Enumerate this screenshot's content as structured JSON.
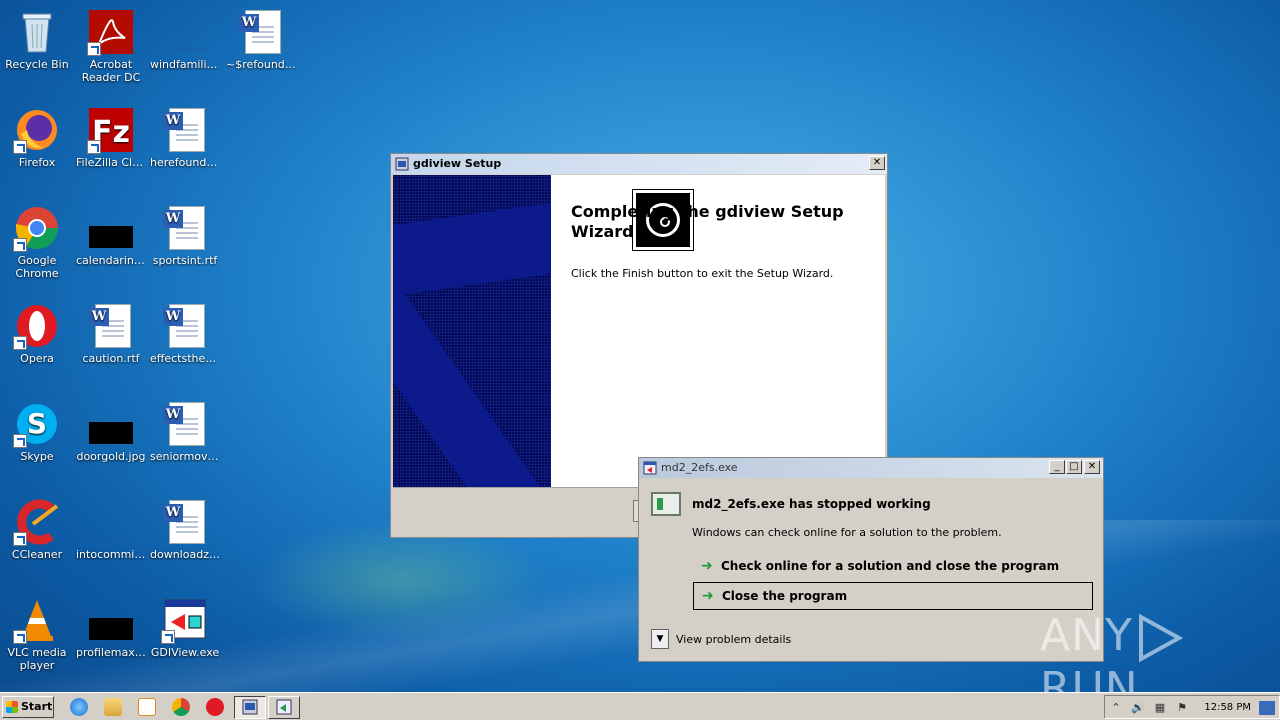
{
  "desktop": {
    "icons": [
      {
        "label": "Recycle Bin",
        "icon": "recycle-bin-icon"
      },
      {
        "label": "Acrobat Reader DC",
        "icon": "acrobat-icon"
      },
      {
        "label": "windfamilie...",
        "icon": "blank-file-icon"
      },
      {
        "label": "~$refounda...",
        "icon": "word-doc-icon"
      },
      {
        "label": "Firefox",
        "icon": "firefox-icon"
      },
      {
        "label": "FileZilla Client",
        "icon": "filezilla-icon"
      },
      {
        "label": "herefounda...",
        "icon": "word-doc-icon"
      },
      {
        "label": "Google Chrome",
        "icon": "chrome-icon"
      },
      {
        "label": "calendarindi...",
        "icon": "image-file-icon"
      },
      {
        "label": "sportsint.rtf",
        "icon": "word-doc-icon"
      },
      {
        "label": "Opera",
        "icon": "opera-icon"
      },
      {
        "label": "caution.rtf",
        "icon": "word-doc-icon"
      },
      {
        "label": "effectstheo...",
        "icon": "word-doc-icon"
      },
      {
        "label": "Skype",
        "icon": "skype-icon"
      },
      {
        "label": "doorgold.jpg",
        "icon": "image-file-icon"
      },
      {
        "label": "seniormovie...",
        "icon": "word-doc-icon"
      },
      {
        "label": "CCleaner",
        "icon": "ccleaner-icon"
      },
      {
        "label": "intocommitt...",
        "icon": "blank-file-icon"
      },
      {
        "label": "downloadz.rtf",
        "icon": "word-doc-icon"
      },
      {
        "label": "VLC media player",
        "icon": "vlc-icon"
      },
      {
        "label": "profilemax.jpg",
        "icon": "image-file-icon"
      },
      {
        "label": "GDIView.exe",
        "icon": "gdiview-icon"
      }
    ]
  },
  "setup_window": {
    "title": "gdiview Setup",
    "heading": "Completing the gdiview Setup Wizard",
    "body": "Click the Finish button to exit the Setup Wizard.",
    "close_label": "✕"
  },
  "error_window": {
    "title": "md2_2efs.exe",
    "heading": "md2_2efs.exe has stopped working",
    "subtext": "Windows can check online for a solution to the problem.",
    "option_check": "Check online for a solution and close the program",
    "option_close": "Close the program",
    "details": "View problem details",
    "min_label": "_",
    "max_label": "□",
    "close_label": "✕"
  },
  "taskbar": {
    "start_label": "Start",
    "clock": "12:58 PM"
  },
  "watermark": {
    "left": "ANY",
    "right": "RUN"
  }
}
